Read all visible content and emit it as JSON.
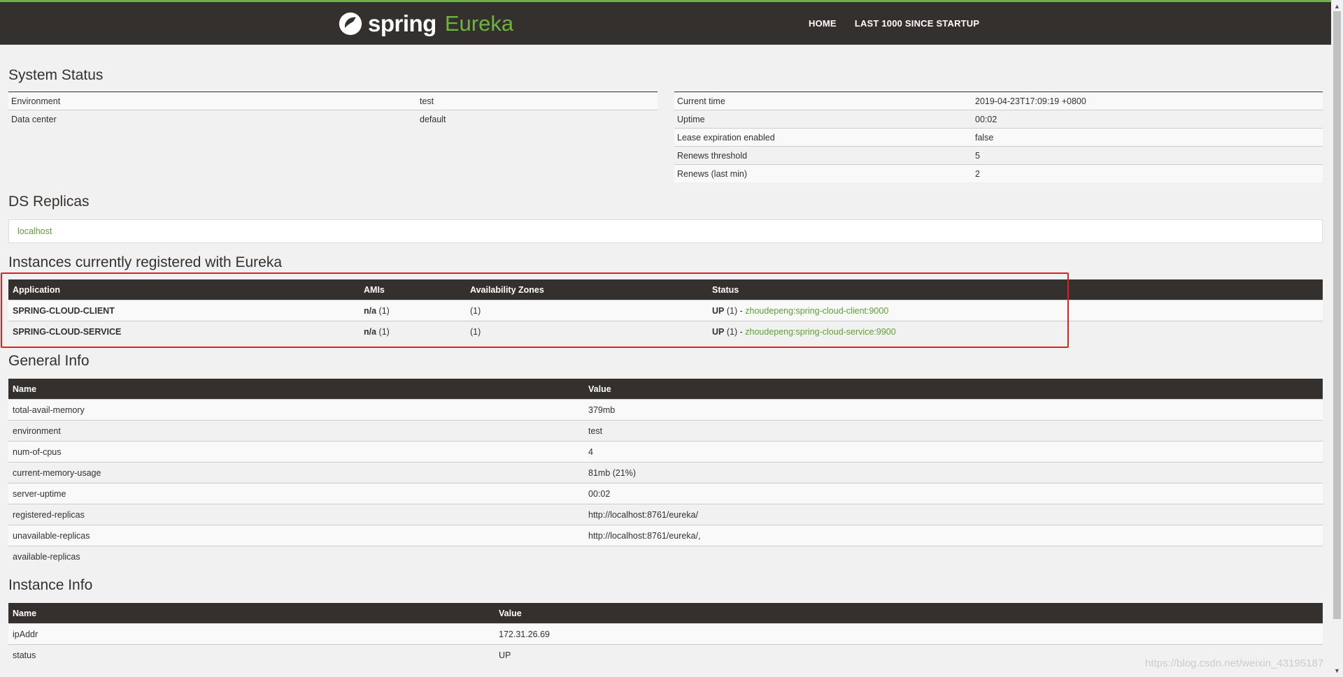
{
  "brand": {
    "name_part1": "spring",
    "name_part2": "Eureka"
  },
  "nav": {
    "home": "HOME",
    "last1000": "LAST 1000 SINCE STARTUP"
  },
  "system_status": {
    "title": "System Status",
    "left": [
      {
        "label": "Environment",
        "value": "test"
      },
      {
        "label": "Data center",
        "value": "default"
      }
    ],
    "right": [
      {
        "label": "Current time",
        "value": "2019-04-23T17:09:19 +0800"
      },
      {
        "label": "Uptime",
        "value": "00:02"
      },
      {
        "label": "Lease expiration enabled",
        "value": "false"
      },
      {
        "label": "Renews threshold",
        "value": "5"
      },
      {
        "label": "Renews (last min)",
        "value": "2"
      }
    ]
  },
  "ds_replicas": {
    "title": "DS Replicas",
    "items": [
      "localhost"
    ]
  },
  "instances": {
    "title": "Instances currently registered with Eureka",
    "headers": [
      "Application",
      "AMIs",
      "Availability Zones",
      "Status"
    ],
    "rows": [
      {
        "app": "SPRING-CLOUD-CLIENT",
        "ami_na": "n/a",
        "ami_count": "(1)",
        "zones": "(1)",
        "status_up": "UP",
        "status_count": "(1) -",
        "link": "zhoudepeng:spring-cloud-client:9000"
      },
      {
        "app": "SPRING-CLOUD-SERVICE",
        "ami_na": "n/a",
        "ami_count": "(1)",
        "zones": "(1)",
        "status_up": "UP",
        "status_count": "(1) -",
        "link": "zhoudepeng:spring-cloud-service:9900"
      }
    ]
  },
  "general_info": {
    "title": "General Info",
    "headers": [
      "Name",
      "Value"
    ],
    "rows": [
      {
        "name": "total-avail-memory",
        "value": "379mb"
      },
      {
        "name": "environment",
        "value": "test"
      },
      {
        "name": "num-of-cpus",
        "value": "4"
      },
      {
        "name": "current-memory-usage",
        "value": "81mb (21%)"
      },
      {
        "name": "server-uptime",
        "value": "00:02"
      },
      {
        "name": "registered-replicas",
        "value": "http://localhost:8761/eureka/"
      },
      {
        "name": "unavailable-replicas",
        "value": "http://localhost:8761/eureka/,"
      },
      {
        "name": "available-replicas",
        "value": ""
      }
    ]
  },
  "instance_info": {
    "title": "Instance Info",
    "headers": [
      "Name",
      "Value"
    ],
    "rows": [
      {
        "name": "ipAddr",
        "value": "172.31.26.69"
      },
      {
        "name": "status",
        "value": "UP"
      }
    ]
  },
  "watermark": "https://blog.csdn.net/weixin_43195187",
  "colors": {
    "accent": "#6db33f",
    "navbar": "#34302d",
    "highlight": "#e02020"
  }
}
